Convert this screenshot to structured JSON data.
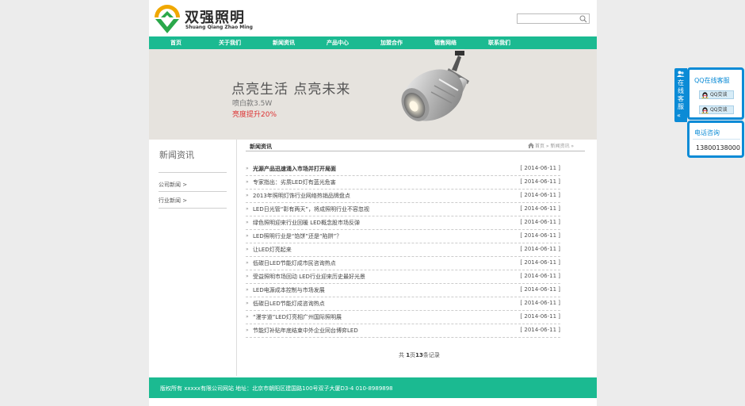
{
  "logo": {
    "cn": "双强照明",
    "en": "Shuang Qiang Zhao Ming"
  },
  "search": {
    "value": "",
    "placeholder": ""
  },
  "nav": [
    "首页",
    "关于我们",
    "新闻资讯",
    "产品中心",
    "加盟合作",
    "销售网络",
    "联系我们"
  ],
  "banner": {
    "slogan": "点亮生活 点亮未来",
    "model": "喷白款3.5W",
    "brightness": "亮度提升20%"
  },
  "sidebar": {
    "title": "新闻资讯",
    "items": [
      "公司新闻 >",
      "行业新闻 >"
    ]
  },
  "main": {
    "title": "新闻资讯",
    "breadcrumb": "首页 » 新闻资讯 »"
  },
  "news": [
    {
      "title": "光源产品迅速涌入市场并打开局面",
      "date": "[ 2014-06-11 ]"
    },
    {
      "title": "专家指出：劣质LED灯有蓝光危害",
      "date": "[ 2014-06-11 ]"
    },
    {
      "title": "2013年照明灯饰行业网络热销品牌盘点",
      "date": "[ 2014-06-11 ]"
    },
    {
      "title": "LED日光管“彰有两天”，将成照明行业不容忽视",
      "date": "[ 2014-06-11 ]"
    },
    {
      "title": "绿色照明迎来行业回暖 LED概念股市场反弹",
      "date": "[ 2014-06-11 ]"
    },
    {
      "title": "LED照明行业是“馅饼”还是“陷阱”？",
      "date": "[ 2014-06-11 ]"
    },
    {
      "title": "让LED灯亮起来",
      "date": "[ 2014-06-11 ]"
    },
    {
      "title": "低碳日LED节能灯成市民咨询热点",
      "date": "[ 2014-06-11 ]"
    },
    {
      "title": "受益照明市场回动 LED行业迎来历史最好光景",
      "date": "[ 2014-06-11 ]"
    },
    {
      "title": "LED电源成本控制与市场发展",
      "date": "[ 2014-06-11 ]"
    },
    {
      "title": "低碳日LED节能灯成咨询热点",
      "date": "[ 2014-06-11 ]"
    },
    {
      "title": "“漫宇道”LED灯亮相广州国际照明展",
      "date": "[ 2014-06-11 ]"
    },
    {
      "title": "节能灯补贴年底结束中外企业同台博弈LED",
      "date": "[ 2014-06-11 ]"
    }
  ],
  "pager": {
    "prefix": "共",
    "page": "1",
    "mid": "页",
    "total": "13",
    "suffix": "条记录"
  },
  "footer": {
    "text": "版权所有 xxxxx有限公司网站 地址：北京市朝阳区建国路100号双子大厦D3-4 010-8989898"
  },
  "qq": {
    "tab_label": "在线客服",
    "title": "QQ在线客服",
    "buttons": [
      "QQ交谈",
      "QQ交谈"
    ]
  },
  "phone": {
    "title": "电话咨询",
    "number": "13800138000"
  },
  "colors": {
    "accent": "#1bba91",
    "qq_blue": "#0b8bd6",
    "highlight": "#dd3333"
  }
}
